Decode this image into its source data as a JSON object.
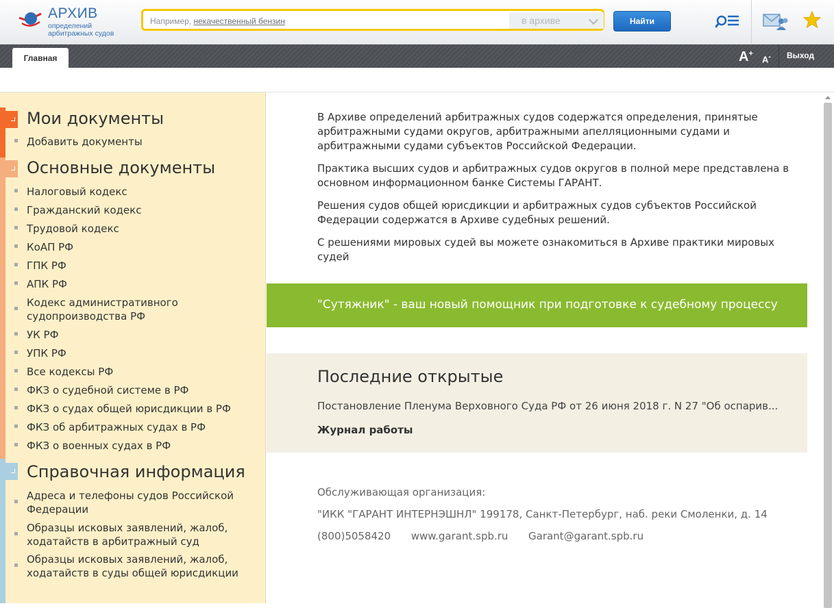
{
  "header": {
    "logo_title": "АРХИВ",
    "logo_sub_line1": "определений",
    "logo_sub_line2": "арбитражных судов",
    "search_prefix": "Например,",
    "search_example": "некачественный бензин",
    "search_scope": "в архиве",
    "find_label": "Найти"
  },
  "nav": {
    "home_tab": "Главная",
    "font_increase": "A",
    "font_increase_sup": "+",
    "font_decrease": "A",
    "font_decrease_sup": "-",
    "logout": "Выход"
  },
  "sidebar": {
    "sections": [
      {
        "title": "Мои документы",
        "color": "#f26b2a",
        "items": [
          "Добавить документы"
        ]
      },
      {
        "title": "Основные документы",
        "color": "#f5ae7d",
        "items": [
          "Налоговый кодекс",
          "Гражданский кодекс",
          "Трудовой кодекс",
          "КоАП РФ",
          "ГПК РФ",
          "АПК РФ",
          "Кодекс административного судопроизводства РФ",
          "УК РФ",
          "УПК РФ",
          "Все кодексы РФ",
          "ФКЗ о судебной системе в РФ",
          "ФКЗ о судах общей юрисдикции в РФ",
          "ФКЗ об арбитражных судах в РФ",
          "ФКЗ о военных судах в РФ"
        ]
      },
      {
        "title": "Справочная информация",
        "color": "#a9cfe0",
        "items": [
          "Адреса и телефоны судов Российской Федерации",
          "Образцы исковых заявлений, жалоб, ходатайств в арбитражный суд",
          "Образцы исковых заявлений, жалоб, ходатайств в суды общей юрисдикции"
        ]
      }
    ]
  },
  "main": {
    "paragraphs": [
      "В Архиве определений арбитражных судов содержатся определения, принятые арбитражными судами округов, арбитражными апелляционными судами и арбитражными судами субъектов Российской Федерации.",
      "Практика высших судов и арбитражных судов округов в полной мере представлена в основном информационном банке Системы ГАРАНТ.",
      "Решения судов общей юрисдикции и арбитражных судов субъектов Российской Федерации содержатся в Архиве судебных решений.",
      "С решениями мировых судей вы можете ознакомиться в Архиве практики мировых судей"
    ],
    "promo": "\"Сутяжник\" - ваш новый помощник при подготовке к судебному процессу",
    "promo_color": "#8aba2f",
    "recent_title": "Последние открытые",
    "recent_doc": "Постановление Пленума Верховного Суда РФ от 26 июня 2018 г. N 27 \"Об оспарив...",
    "recent_log": "Журнал работы",
    "footer_label": "Обслуживающая организация:",
    "footer_org": "\"ИКК \"ГАРАНТ ИНТЕРНЭШНЛ\"  199178, Санкт-Петербург, наб. реки Смоленки, д. 14",
    "footer_phone": "(800)5058420",
    "footer_site": "www.garant.spb.ru",
    "footer_email": "Garant@garant.spb.ru"
  },
  "icons": {
    "logo": "archive-logo-icon",
    "search_list": "search-list-icon",
    "mail": "mail-users-icon",
    "star": "star-icon"
  }
}
